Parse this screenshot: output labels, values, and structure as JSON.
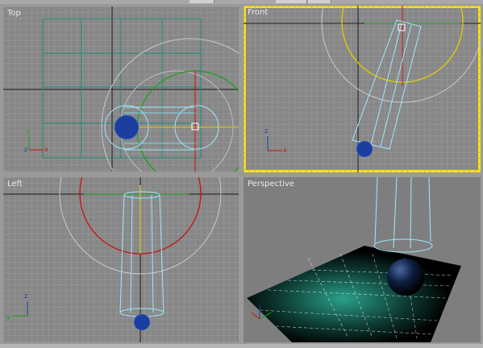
{
  "viewports": {
    "top": {
      "label": "Top"
    },
    "front": {
      "label": "Front"
    },
    "left": {
      "label": "Left"
    },
    "perspective": {
      "label": "Perspective"
    }
  },
  "axis_labels": {
    "x": "x",
    "y": "y",
    "z": "z"
  },
  "colors": {
    "viewport_bg": "#878787",
    "grid_line": "#9c9c9c",
    "active_border": "#ffe400",
    "cylinder_wire": "#9fe8ff",
    "sphere": "#1b3fa0",
    "circle_red": "#c81010",
    "circle_green": "#1aa01a",
    "circle_yellow": "#e0d000",
    "plane_black": "#000000",
    "light_teal": "#1f8a78"
  }
}
